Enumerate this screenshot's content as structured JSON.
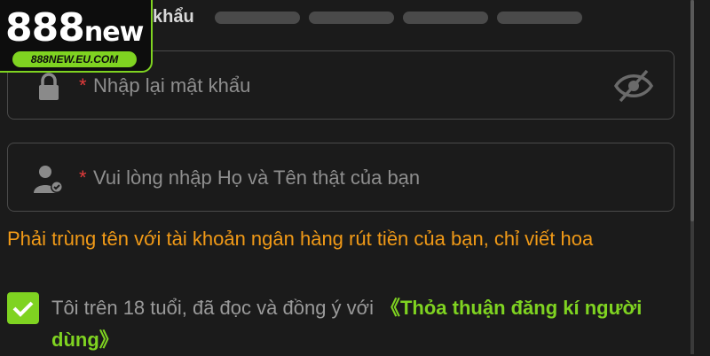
{
  "logo": {
    "brand_number": "888",
    "brand_word": "new",
    "url": "888NEW.EU.COM"
  },
  "password_label_tail": "khẩu",
  "confirm_password": {
    "required_mark": "*",
    "placeholder": "Nhập lại mật khẩu"
  },
  "full_name": {
    "required_mark": "*",
    "placeholder": "Vui lòng nhập Họ và Tên thật của bạn"
  },
  "name_hint": "Phải trùng tên với tài khoản ngân hàng rút tiền của bạn, chỉ viết hoa",
  "agreement": {
    "text": "Tôi trên 18 tuổi, đã đọc và đồng ý với",
    "link": "《Thỏa thuận đăng kí người dùng》",
    "checked": true
  },
  "colors": {
    "accent": "#7fd321",
    "hint": "#f19a17",
    "required": "#e23b3b",
    "background": "#1b1b1b"
  },
  "icons": {
    "confirm_password": "lock-icon",
    "full_name": "user-check-icon",
    "toggle": "eye-off-icon",
    "checkbox": "check-icon"
  }
}
